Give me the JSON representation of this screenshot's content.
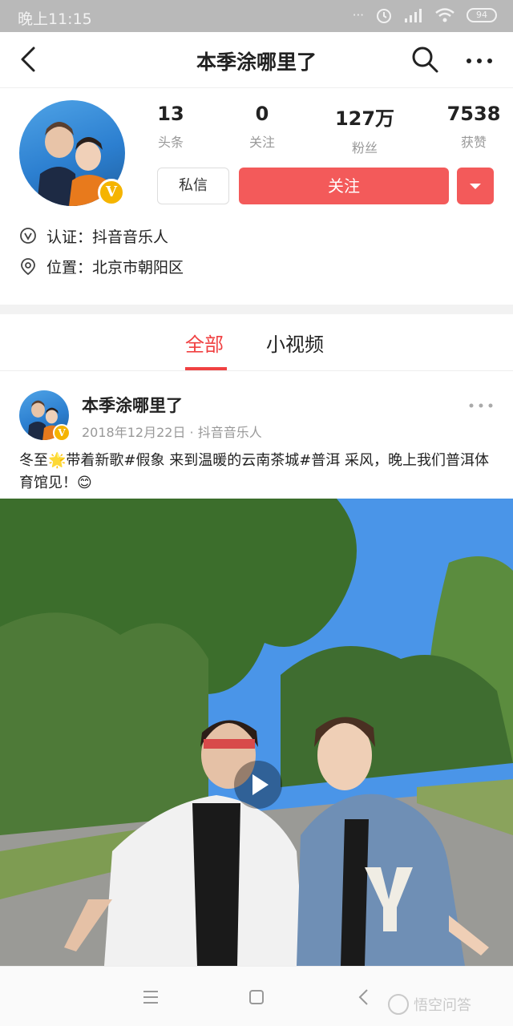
{
  "status_bar": {
    "time": "晚上11:15",
    "battery": "94"
  },
  "nav": {
    "title": "本季涂哪里了"
  },
  "profile": {
    "stats": [
      {
        "value": "13",
        "label": "头条"
      },
      {
        "value": "0",
        "label": "关注"
      },
      {
        "value": "127万",
        "label": "粉丝"
      },
      {
        "value": "7538",
        "label": "获赞"
      }
    ],
    "message_button": "私信",
    "follow_button": "关注",
    "verification": "认证：抖音音乐人",
    "location": "位置：北京市朝阳区"
  },
  "tabs": [
    {
      "label": "全部",
      "active": true
    },
    {
      "label": "小视频",
      "active": false
    }
  ],
  "post": {
    "author": "本季涂哪里了",
    "meta": "2018年12月22日 · 抖音音乐人",
    "text": "冬至🌟带着新歌#假象 来到温暖的云南茶城#普洱 采风，晚上我们普洱体育馆见！😊"
  },
  "watermark": "悟空问答",
  "colors": {
    "accent": "#f35a5a",
    "tab_active": "#f04142",
    "badge": "#f5b400"
  }
}
